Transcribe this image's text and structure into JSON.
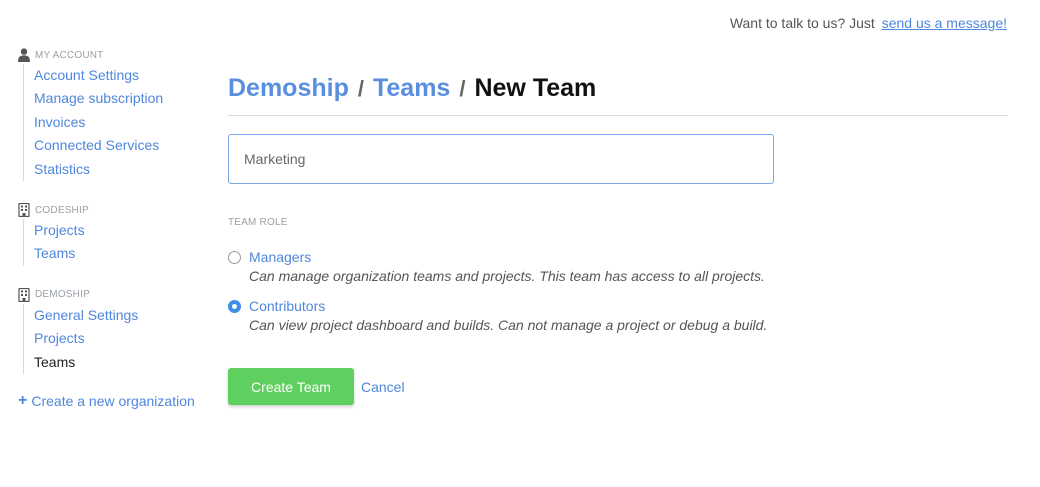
{
  "help": {
    "prefix": "Want to talk to us? Just",
    "link": "send us a message!"
  },
  "sidebar": {
    "groups": [
      {
        "title": "MY ACCOUNT",
        "icon": "user-icon",
        "items": [
          {
            "label": "Account Settings"
          },
          {
            "label": "Manage subscription"
          },
          {
            "label": "Invoices"
          },
          {
            "label": "Connected Services"
          },
          {
            "label": "Statistics"
          }
        ]
      },
      {
        "title": "CODESHIP",
        "icon": "building-icon",
        "items": [
          {
            "label": "Projects"
          },
          {
            "label": "Teams"
          }
        ]
      },
      {
        "title": "DEMOSHIP",
        "icon": "building-icon",
        "items": [
          {
            "label": "General Settings"
          },
          {
            "label": "Projects"
          },
          {
            "label": "Teams",
            "active": true
          }
        ]
      }
    ],
    "create_org": "Create a new organization"
  },
  "breadcrumb": {
    "org": "Demoship",
    "section": "Teams",
    "separator": "/",
    "current": "New Team"
  },
  "form": {
    "team_name_value": "Marketing",
    "role_label": "TEAM ROLE",
    "roles": [
      {
        "title": "Managers",
        "description": "Can manage organization teams and projects. This team has access to all projects.",
        "checked": false
      },
      {
        "title": "Contributors",
        "description": "Can view project dashboard and builds. Can not manage a project or debug a build.",
        "checked": true
      }
    ],
    "submit_label": "Create Team",
    "cancel_label": "Cancel"
  },
  "colors": {
    "link": "#4f87dd",
    "primary_button": "#5fcf5f",
    "radio_checked": "#3b8fe8"
  }
}
